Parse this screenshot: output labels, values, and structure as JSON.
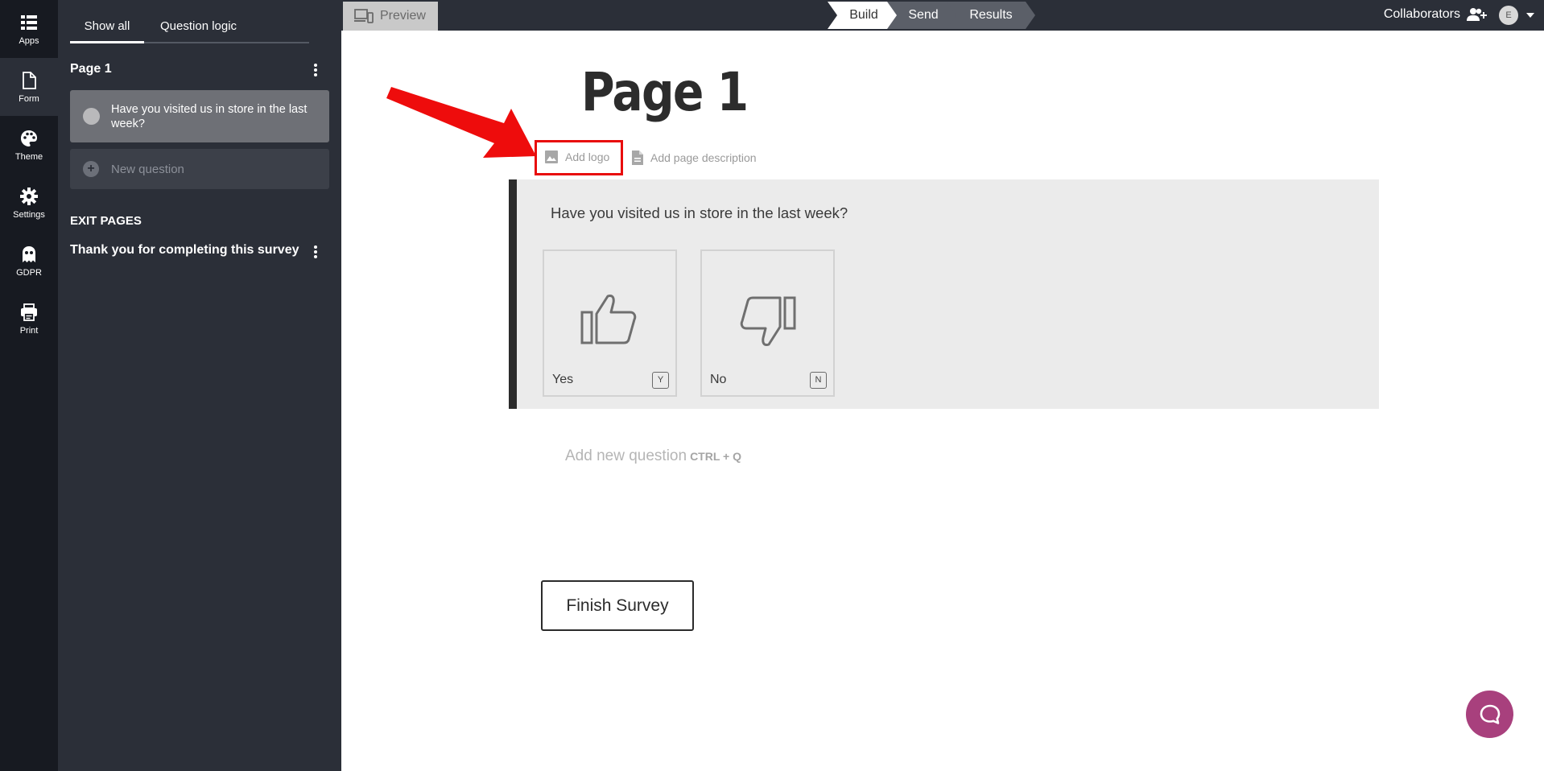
{
  "rail": {
    "items": [
      {
        "label": "Apps",
        "icon": "apps-grid-icon"
      },
      {
        "label": "Form",
        "icon": "document-icon"
      },
      {
        "label": "Theme",
        "icon": "palette-icon"
      },
      {
        "label": "Settings",
        "icon": "gear-icon"
      },
      {
        "label": "GDPR",
        "icon": "ghost-icon"
      },
      {
        "label": "Print",
        "icon": "printer-icon"
      }
    ]
  },
  "panel": {
    "tabs": [
      "Show all",
      "Question logic"
    ],
    "page_heading": "Page 1",
    "questions": [
      "Have you visited us in store in the last week?"
    ],
    "new_question": "New question",
    "exit_heading": "EXIT PAGES",
    "exit_pages": [
      "Thank you for completing this survey"
    ]
  },
  "topbar": {
    "preview": "Preview",
    "steps": [
      "Build",
      "Send",
      "Results"
    ],
    "active_step": "Build",
    "collaborators": "Collaborators",
    "user_initial": "E"
  },
  "canvas": {
    "page_title": "Page 1",
    "add_logo": "Add logo",
    "add_page_description": "Add page description",
    "question": {
      "title": "Have you visited us in store in the last week?",
      "choices": [
        {
          "label": "Yes",
          "key": "Y",
          "icon": "thumbs-up-icon"
        },
        {
          "label": "No",
          "key": "N",
          "icon": "thumbs-down-icon"
        }
      ]
    },
    "add_new_question": "Add new question",
    "add_new_question_shortcut": "CTRL + Q",
    "finish_button": "Finish Survey"
  },
  "colors": {
    "rail_bg": "#171a21",
    "panel_bg": "#2b2f38",
    "highlight_red": "#e80c0c",
    "chat_purple": "#a8407d"
  }
}
